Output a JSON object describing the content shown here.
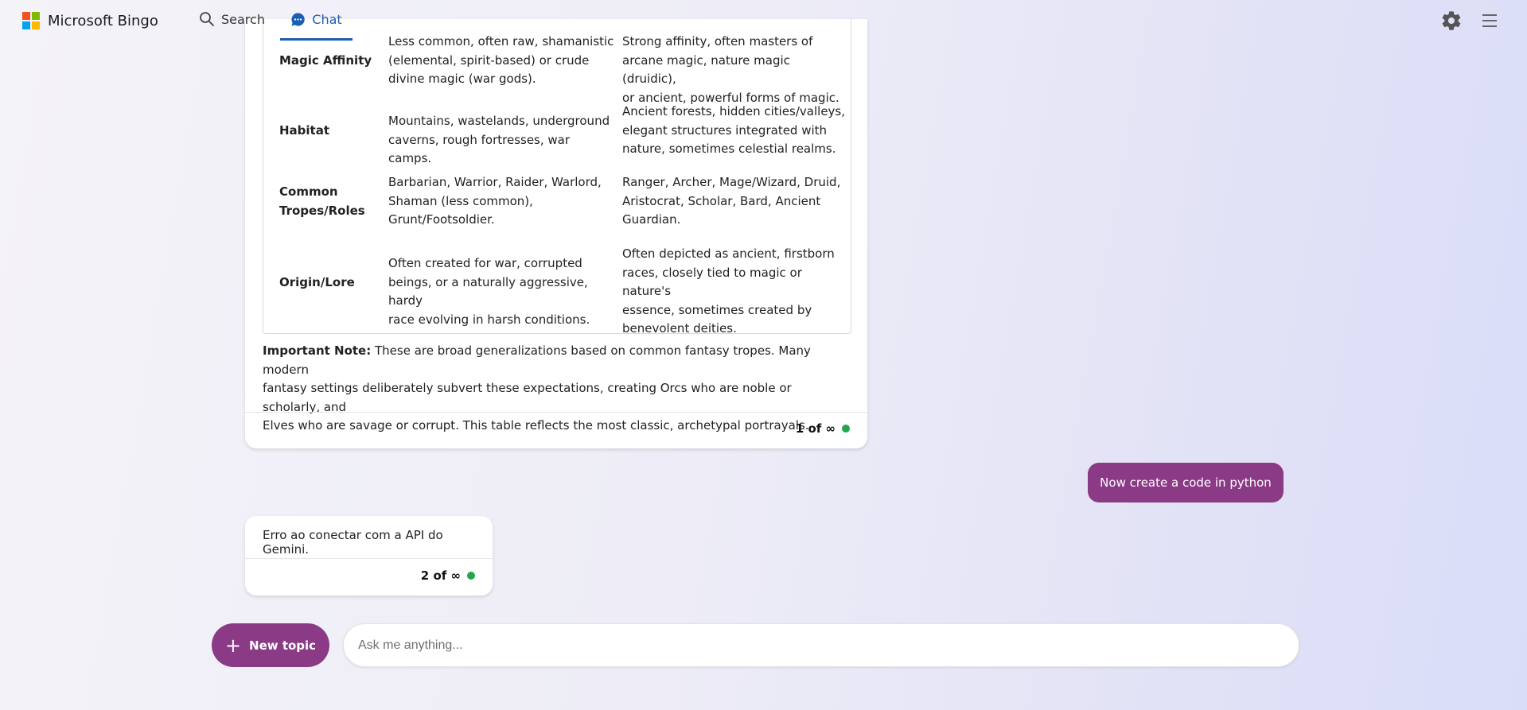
{
  "header": {
    "brand": "Microsoft Bingo",
    "logo_colors": [
      "#f25022",
      "#7fba00",
      "#00a4ef",
      "#ffb900"
    ],
    "nav": {
      "search_label": "Search",
      "chat_label": "Chat"
    },
    "accent": "#1a5fb4"
  },
  "table": {
    "rows": [
      {
        "label": "Magic Affinity",
        "col_a": [
          "Less common, often raw, shamanistic",
          "(elemental, spirit-based) or crude",
          "divine magic (war gods)."
        ],
        "col_b": [
          "Strong affinity, often masters of",
          "arcane magic, nature magic (druidic),",
          "or ancient, powerful forms of magic."
        ]
      },
      {
        "label": "Habitat",
        "col_a": [
          "Mountains, wastelands, underground",
          "caverns, rough fortresses, war camps."
        ],
        "col_b": [
          "Ancient forests, hidden cities/valleys,",
          "elegant structures integrated with",
          "nature, sometimes celestial realms."
        ]
      },
      {
        "label": [
          "Common",
          "Tropes/Roles"
        ],
        "col_a": [
          "Barbarian, Warrior, Raider, Warlord,",
          "Shaman (less common),",
          "Grunt/Footsoldier."
        ],
        "col_b": [
          "Ranger, Archer, Mage/Wizard, Druid,",
          "Aristocrat, Scholar, Bard, Ancient",
          "Guardian."
        ]
      },
      {
        "label": "Origin/Lore",
        "col_a": [
          "Often created for war, corrupted",
          "beings, or a naturally aggressive, hardy",
          "race evolving in harsh conditions."
        ],
        "col_b": [
          "Often depicted as ancient, firstborn",
          "races, closely tied to magic or nature's",
          "essence, sometimes created by",
          "benevolent deities."
        ]
      }
    ]
  },
  "note": {
    "label": "Important Note:",
    "line1": " These are broad generalizations based on common fantasy tropes. Many modern",
    "line2": "fantasy settings deliberately subvert these expectations, creating Orcs who are noble or scholarly, and",
    "line3": "Elves who are savage or corrupt. This table reflects the most classic, archetypal portrayals."
  },
  "message1": {
    "counter": "1 of ∞"
  },
  "user_message": "Now create a code in python",
  "message2": {
    "text": "Erro ao conectar com a API do Gemini.",
    "counter": "2 of ∞"
  },
  "composer": {
    "new_topic_label": "New topic",
    "placeholder": "Ask me anything..."
  },
  "colors": {
    "purple": "#8b3a86",
    "status_green": "#22a64b"
  }
}
